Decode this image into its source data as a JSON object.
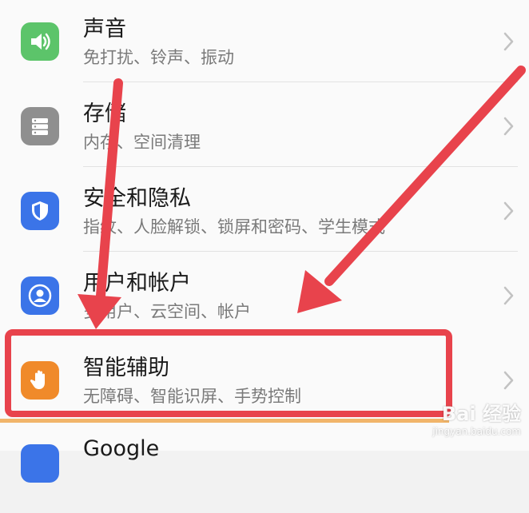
{
  "settings": {
    "items": [
      {
        "title": "声音",
        "subtitle": "免打扰、铃声、振动",
        "icon": "speaker-icon",
        "color": "#5cc46a"
      },
      {
        "title": "存储",
        "subtitle": "内存、空间清理",
        "icon": "storage-icon",
        "color": "#8f8f8f"
      },
      {
        "title": "安全和隐私",
        "subtitle": "指纹、人脸解锁、锁屏和密码、学生模式",
        "icon": "shield-icon",
        "color": "#3b74e8"
      },
      {
        "title": "用户和帐户",
        "subtitle": "多用户、云空间、帐户",
        "icon": "user-icon",
        "color": "#3b74e8"
      },
      {
        "title": "智能辅助",
        "subtitle": "无障碍、智能识屏、手势控制",
        "icon": "hand-icon",
        "color": "#f08a2a"
      },
      {
        "title": "Google",
        "subtitle": "",
        "icon": "google-icon",
        "color": "#3b74e8"
      }
    ]
  },
  "annotation": {
    "arrow_color": "#e8434c",
    "highlight_color": "#e8434c"
  },
  "watermark": {
    "main": "Bai 经验",
    "sub": "jingyan.baidu.com"
  }
}
